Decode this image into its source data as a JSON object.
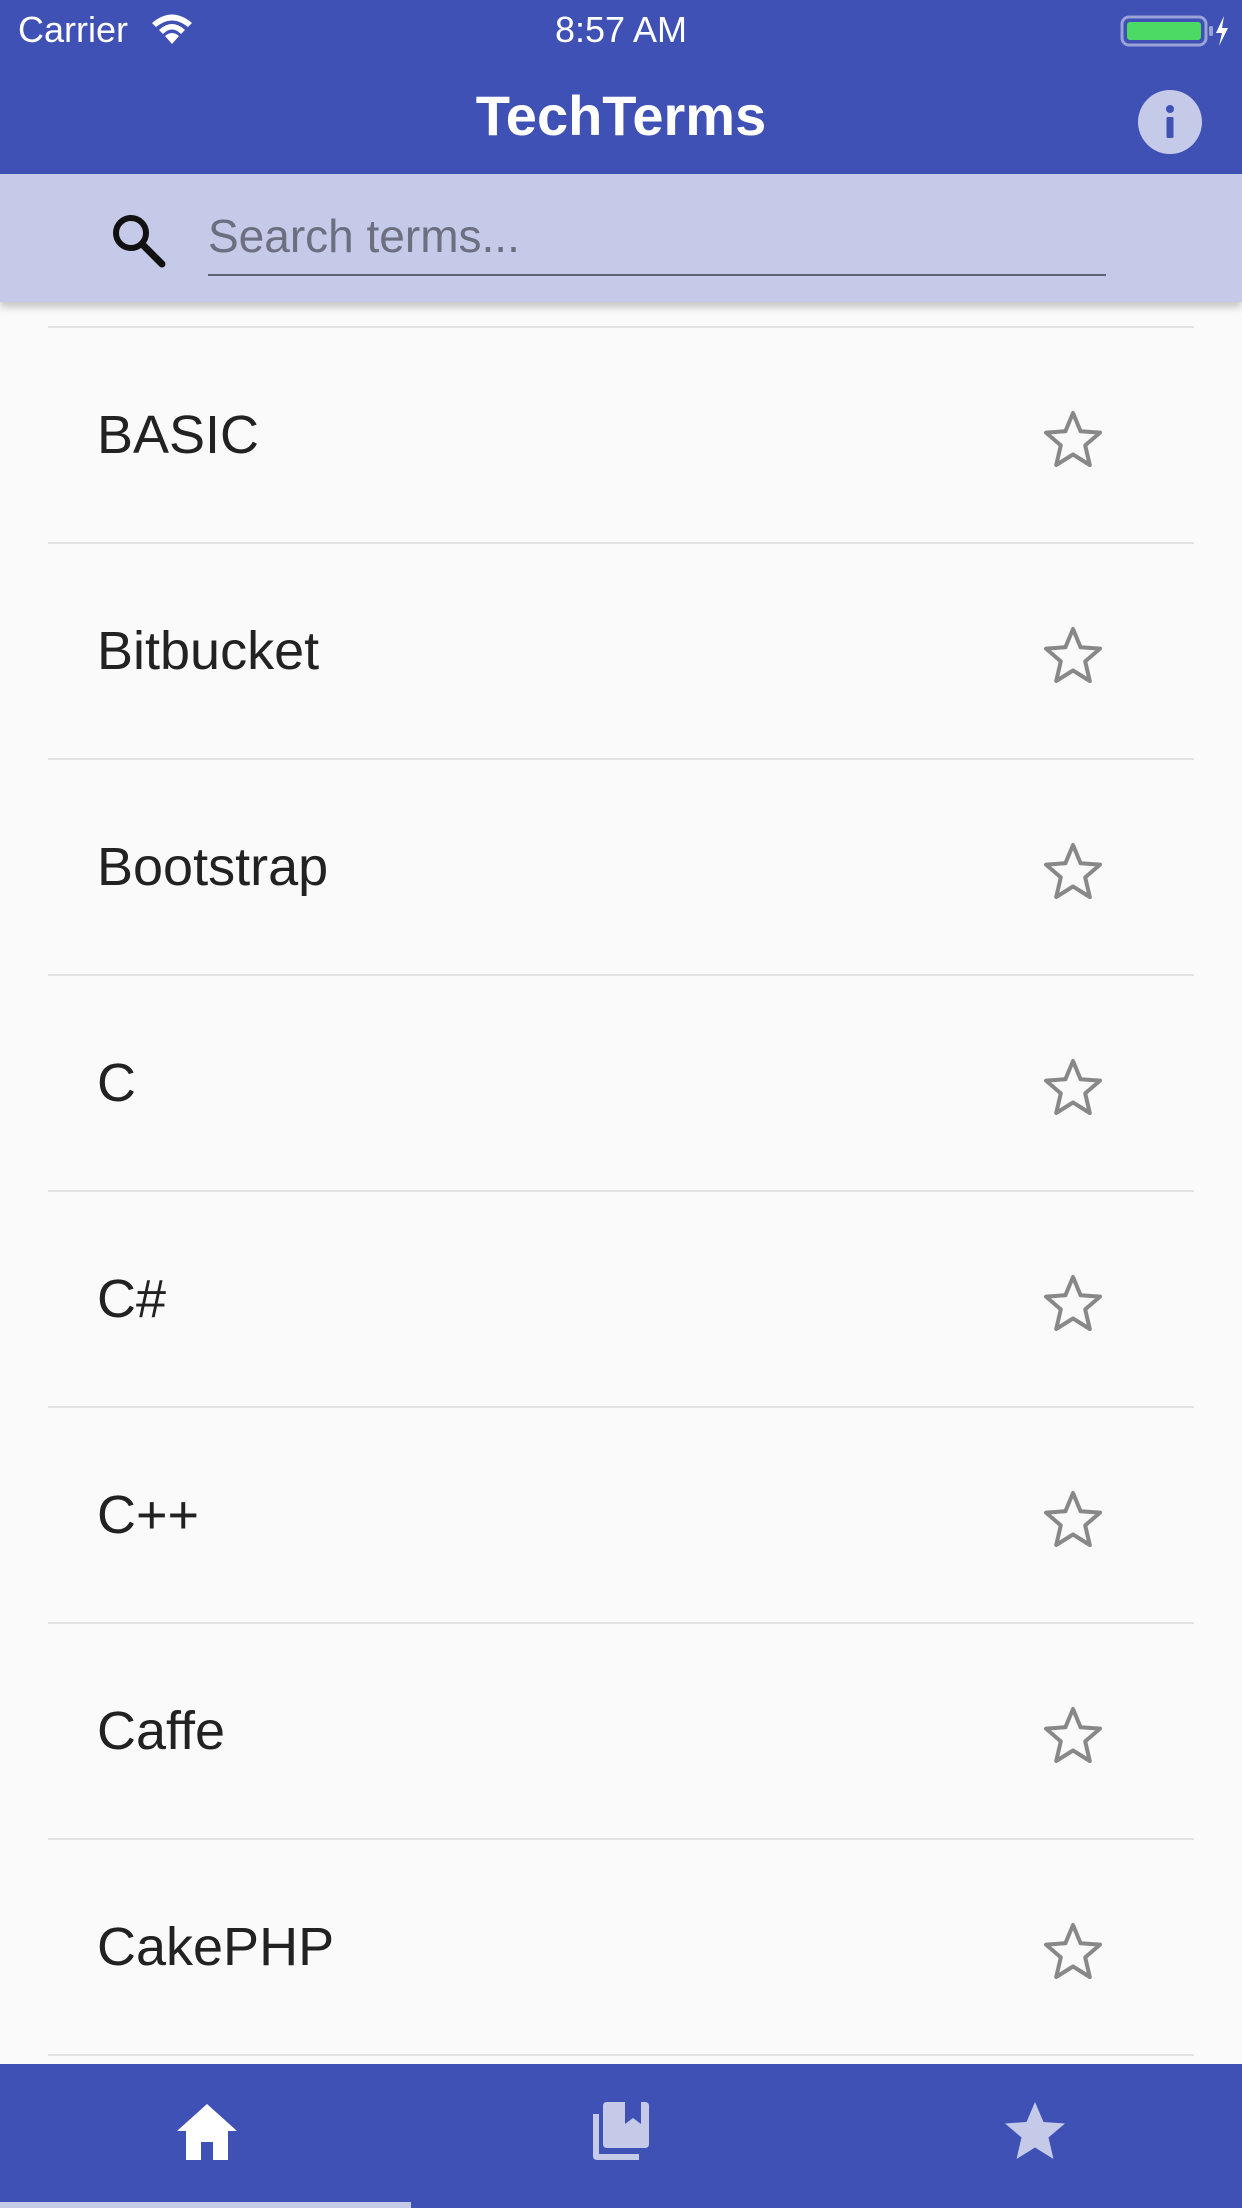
{
  "status_bar": {
    "carrier": "Carrier",
    "time": "8:57 AM",
    "wifi_icon": "wifi-icon",
    "battery_icon": "battery-charging-icon"
  },
  "app_bar": {
    "title": "TechTerms",
    "info_icon": "info-icon"
  },
  "search": {
    "placeholder": "Search terms...",
    "value": "",
    "icon": "search-icon"
  },
  "terms": [
    {
      "label": "BASIC",
      "starred": false
    },
    {
      "label": "Bitbucket",
      "starred": false
    },
    {
      "label": "Bootstrap",
      "starred": false
    },
    {
      "label": "C",
      "starred": false
    },
    {
      "label": "C#",
      "starred": false
    },
    {
      "label": "C++",
      "starred": false
    },
    {
      "label": "Caffe",
      "starred": false
    },
    {
      "label": "CakePHP",
      "starred": false
    }
  ],
  "bottom_nav": {
    "tabs": [
      {
        "icon": "home-icon",
        "active": true
      },
      {
        "icon": "library-bookmark-icon",
        "active": false
      },
      {
        "icon": "star-icon",
        "active": false
      }
    ]
  },
  "colors": {
    "primary": "#3f51b5",
    "primary_light": "#c5cae9",
    "background": "#fafafa",
    "divider": "#e3e3e3",
    "star_outline": "#888888",
    "text": "#222222"
  }
}
